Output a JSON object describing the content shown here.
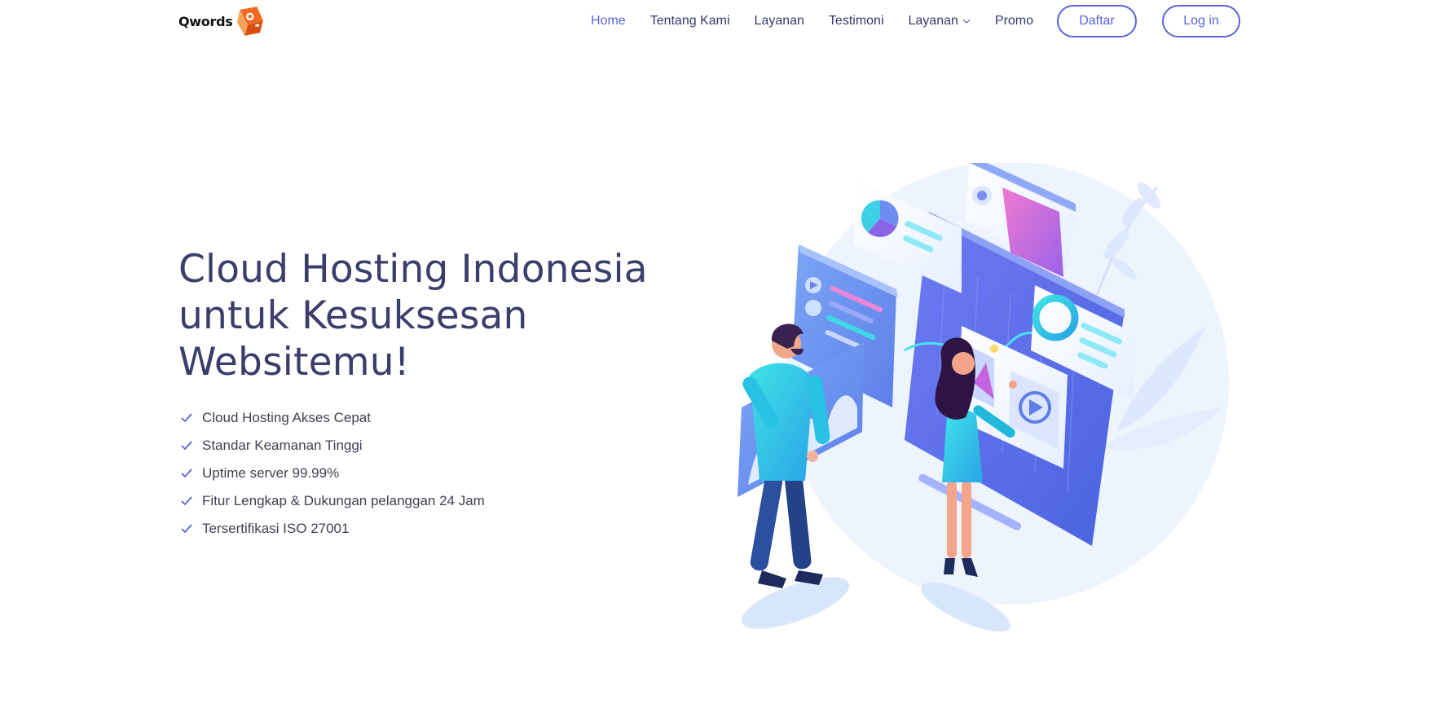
{
  "header": {
    "logo": {
      "text": "Qwords",
      "icon": "qwords-logo-mark",
      "accent": "#f26a21"
    },
    "nav": [
      {
        "label": "Home",
        "active": true
      },
      {
        "label": "Tentang Kami"
      },
      {
        "label": "Layanan"
      },
      {
        "label": "Testimoni"
      },
      {
        "label": "Layanan",
        "icon": "chevron-down-icon"
      },
      {
        "label": "Promo"
      }
    ],
    "daftar_label": "Daftar",
    "login_label": "Log in"
  },
  "hero": {
    "title": "Cloud Hosting Indonesia untuk Kesuksesan Websitemu!",
    "features": [
      "Cloud Hosting Akses Cepat",
      "Standar Keamanan Tinggi",
      "Uptime server 99.99%",
      "Fitur Lengkap & Dukungan pelanggan 24 Jam",
      "Tersertifikasi ISO 27001"
    ],
    "check_icon": "check-icon"
  },
  "colors": {
    "accent": "#5a63d8",
    "title": "#3b3d6b",
    "text": "#3f4150",
    "logo_orange": "#f26a21"
  }
}
